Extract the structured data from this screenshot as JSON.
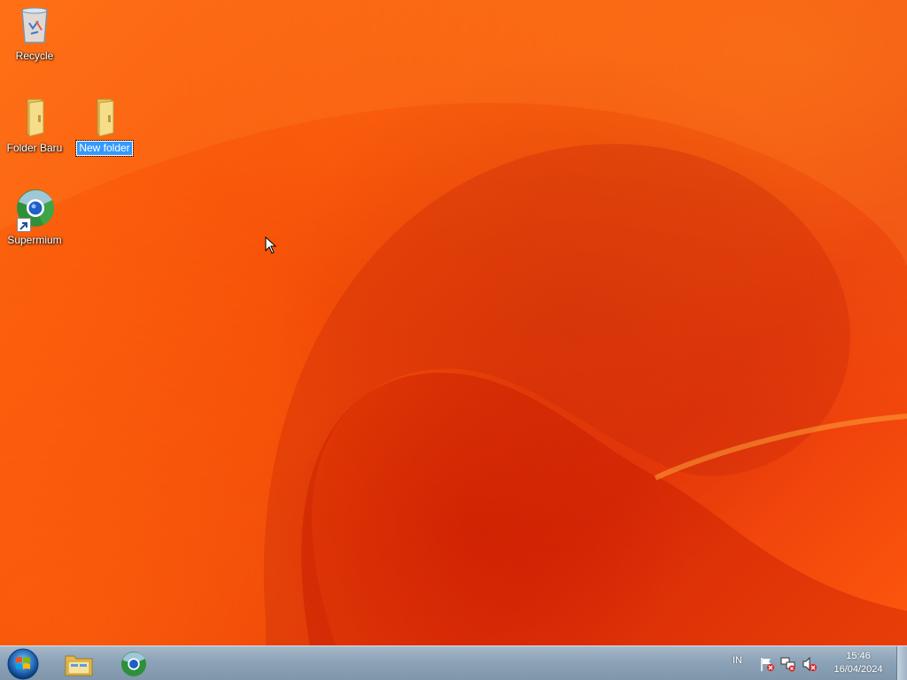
{
  "desktop": {
    "icons": [
      {
        "label": "Recycle",
        "icon": "recycle-bin-icon",
        "selected": false
      },
      {
        "label": "Folder Baru",
        "icon": "folder-icon",
        "selected": false
      },
      {
        "label": "New folder",
        "icon": "folder-icon",
        "selected": true
      },
      {
        "label": "Supermium",
        "icon": "supermium-browser-icon",
        "selected": false
      }
    ],
    "wallpaper_colors": [
      "#ff6a10",
      "#e8380a",
      "#c81400"
    ]
  },
  "taskbar": {
    "pinned": [
      {
        "name": "windows-explorer",
        "icon": "folder-icon"
      },
      {
        "name": "supermium",
        "icon": "supermium-browser-icon"
      }
    ],
    "tray": {
      "language": "IN",
      "icons": [
        "action-center-flag-icon",
        "network-icon",
        "volume-muted-icon"
      ]
    },
    "clock": {
      "time": "15:46",
      "date": "16/04/2024"
    }
  },
  "colors": {
    "selection": "#3399ff",
    "taskbar": "#8ea4b8"
  }
}
